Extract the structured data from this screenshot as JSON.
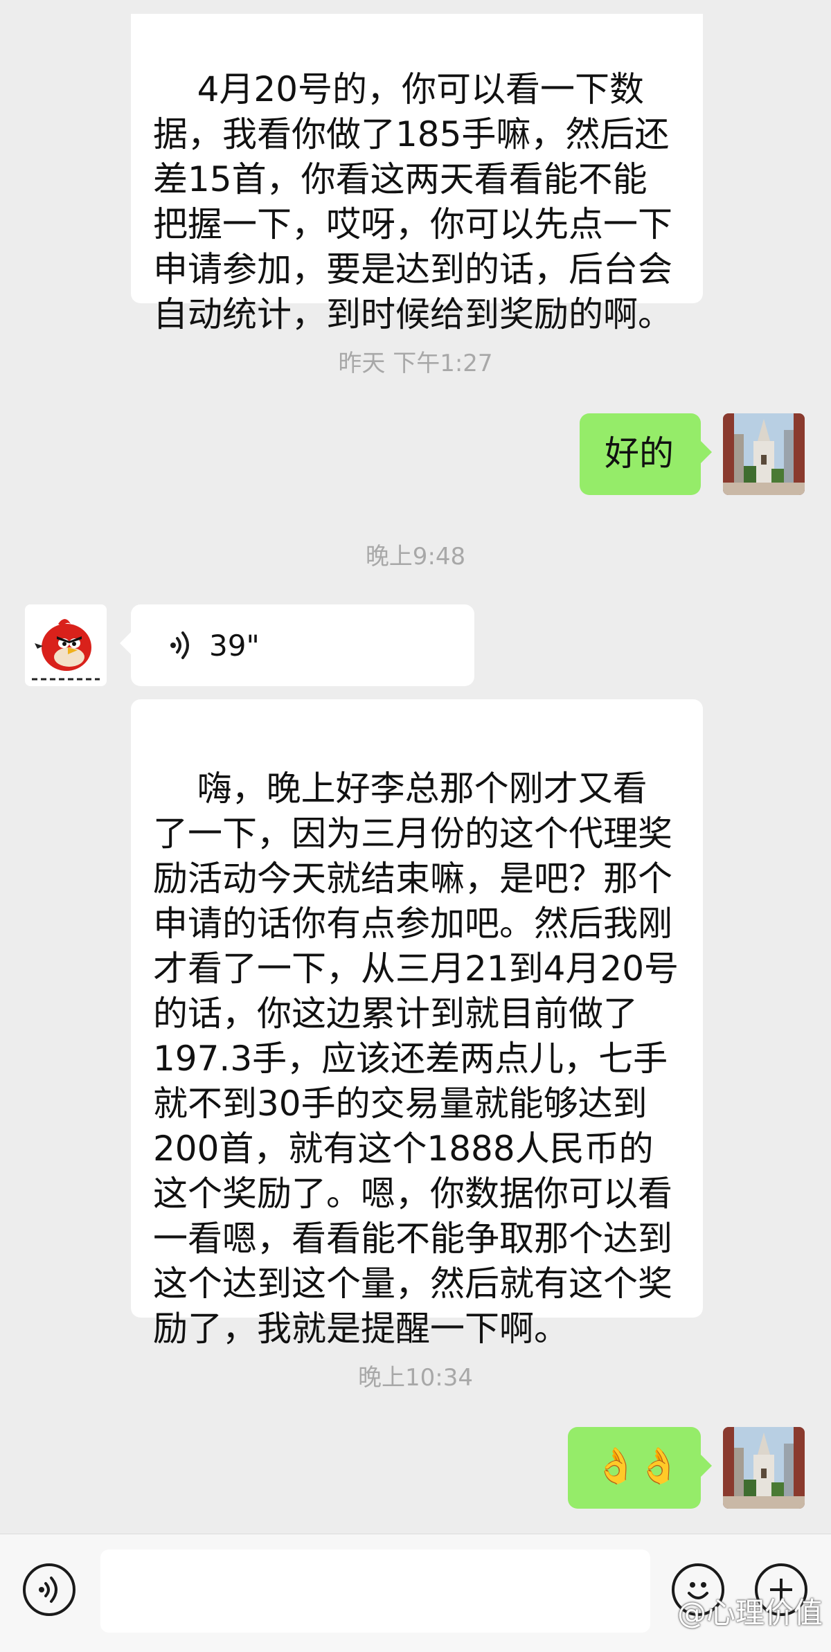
{
  "messages": {
    "m1_text": "4月20号的，你可以看一下数据，我看你做了185手嘛，然后还差15首，你看这两天看看能不能把握一下，哎呀，你可以先点一下申请参加，要是达到的话，后台会自动统计，到时候给到奖励的啊。",
    "time1": "昨天 下午1:27",
    "m2_text": "好的",
    "time2": "晚上9:48",
    "voice_duration": "39\"",
    "m4_text": "嗨，晚上好李总那个刚才又看了一下，因为三月份的这个代理奖励活动今天就结束嘛，是吧？那个申请的话你有点参加吧。然后我刚才看了一下，从三月21到4月20号的话，你这边累计到就目前做了197.3手，应该还差两点儿，七手就不到30手的交易量就能够达到200首，就有这个1888人民币的这个奖励了。嗯，你数据你可以看一看嗯，看看能不能争取那个达到这个达到这个量，然后就有这个奖励了，我就是提醒一下啊。",
    "time3": "晚上10:34",
    "m5_emoji": "👌👌"
  },
  "input_bar": {
    "voice_icon": "voice-icon",
    "emoji_icon": "smiley-icon",
    "plus_icon": "plus-icon",
    "text_value": ""
  },
  "watermark": "@心理价值",
  "colors": {
    "background": "#ededed",
    "sent_bubble": "#95ec69",
    "received_bubble": "#ffffff",
    "timestamp": "#a8a8a8"
  }
}
